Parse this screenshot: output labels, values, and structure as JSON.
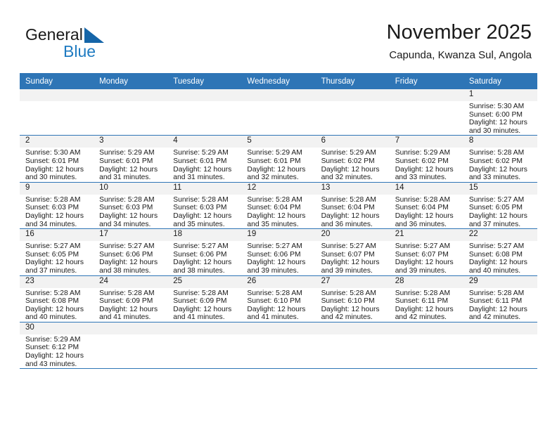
{
  "brand": {
    "name_top": "General",
    "name_bottom": "Blue",
    "flag_icon": "blue-flag-triangle-icon",
    "accent_color": "#1f7bc1"
  },
  "header": {
    "title": "November 2025",
    "subtitle": "Capunda, Kwanza Sul, Angola"
  },
  "theme": {
    "header_blue": "#2e75b6",
    "daynum_band": "#f2f2f2",
    "text": "#1a1a1a"
  },
  "calendar": {
    "weekday_headers": [
      "Sunday",
      "Monday",
      "Tuesday",
      "Wednesday",
      "Thursday",
      "Friday",
      "Saturday"
    ],
    "weeks": [
      [
        {
          "empty": true,
          "day": "",
          "sunrise": "",
          "sunset": "",
          "daylight_l1": "",
          "daylight_l2": ""
        },
        {
          "empty": true,
          "day": "",
          "sunrise": "",
          "sunset": "",
          "daylight_l1": "",
          "daylight_l2": ""
        },
        {
          "empty": true,
          "day": "",
          "sunrise": "",
          "sunset": "",
          "daylight_l1": "",
          "daylight_l2": ""
        },
        {
          "empty": true,
          "day": "",
          "sunrise": "",
          "sunset": "",
          "daylight_l1": "",
          "daylight_l2": ""
        },
        {
          "empty": true,
          "day": "",
          "sunrise": "",
          "sunset": "",
          "daylight_l1": "",
          "daylight_l2": ""
        },
        {
          "empty": true,
          "day": "",
          "sunrise": "",
          "sunset": "",
          "daylight_l1": "",
          "daylight_l2": ""
        },
        {
          "empty": false,
          "day": "1",
          "sunrise": "Sunrise: 5:30 AM",
          "sunset": "Sunset: 6:00 PM",
          "daylight_l1": "Daylight: 12 hours",
          "daylight_l2": "and 30 minutes."
        }
      ],
      [
        {
          "empty": false,
          "day": "2",
          "sunrise": "Sunrise: 5:30 AM",
          "sunset": "Sunset: 6:01 PM",
          "daylight_l1": "Daylight: 12 hours",
          "daylight_l2": "and 30 minutes."
        },
        {
          "empty": false,
          "day": "3",
          "sunrise": "Sunrise: 5:29 AM",
          "sunset": "Sunset: 6:01 PM",
          "daylight_l1": "Daylight: 12 hours",
          "daylight_l2": "and 31 minutes."
        },
        {
          "empty": false,
          "day": "4",
          "sunrise": "Sunrise: 5:29 AM",
          "sunset": "Sunset: 6:01 PM",
          "daylight_l1": "Daylight: 12 hours",
          "daylight_l2": "and 31 minutes."
        },
        {
          "empty": false,
          "day": "5",
          "sunrise": "Sunrise: 5:29 AM",
          "sunset": "Sunset: 6:01 PM",
          "daylight_l1": "Daylight: 12 hours",
          "daylight_l2": "and 32 minutes."
        },
        {
          "empty": false,
          "day": "6",
          "sunrise": "Sunrise: 5:29 AM",
          "sunset": "Sunset: 6:02 PM",
          "daylight_l1": "Daylight: 12 hours",
          "daylight_l2": "and 32 minutes."
        },
        {
          "empty": false,
          "day": "7",
          "sunrise": "Sunrise: 5:29 AM",
          "sunset": "Sunset: 6:02 PM",
          "daylight_l1": "Daylight: 12 hours",
          "daylight_l2": "and 33 minutes."
        },
        {
          "empty": false,
          "day": "8",
          "sunrise": "Sunrise: 5:28 AM",
          "sunset": "Sunset: 6:02 PM",
          "daylight_l1": "Daylight: 12 hours",
          "daylight_l2": "and 33 minutes."
        }
      ],
      [
        {
          "empty": false,
          "day": "9",
          "sunrise": "Sunrise: 5:28 AM",
          "sunset": "Sunset: 6:03 PM",
          "daylight_l1": "Daylight: 12 hours",
          "daylight_l2": "and 34 minutes."
        },
        {
          "empty": false,
          "day": "10",
          "sunrise": "Sunrise: 5:28 AM",
          "sunset": "Sunset: 6:03 PM",
          "daylight_l1": "Daylight: 12 hours",
          "daylight_l2": "and 34 minutes."
        },
        {
          "empty": false,
          "day": "11",
          "sunrise": "Sunrise: 5:28 AM",
          "sunset": "Sunset: 6:03 PM",
          "daylight_l1": "Daylight: 12 hours",
          "daylight_l2": "and 35 minutes."
        },
        {
          "empty": false,
          "day": "12",
          "sunrise": "Sunrise: 5:28 AM",
          "sunset": "Sunset: 6:04 PM",
          "daylight_l1": "Daylight: 12 hours",
          "daylight_l2": "and 35 minutes."
        },
        {
          "empty": false,
          "day": "13",
          "sunrise": "Sunrise: 5:28 AM",
          "sunset": "Sunset: 6:04 PM",
          "daylight_l1": "Daylight: 12 hours",
          "daylight_l2": "and 36 minutes."
        },
        {
          "empty": false,
          "day": "14",
          "sunrise": "Sunrise: 5:28 AM",
          "sunset": "Sunset: 6:04 PM",
          "daylight_l1": "Daylight: 12 hours",
          "daylight_l2": "and 36 minutes."
        },
        {
          "empty": false,
          "day": "15",
          "sunrise": "Sunrise: 5:27 AM",
          "sunset": "Sunset: 6:05 PM",
          "daylight_l1": "Daylight: 12 hours",
          "daylight_l2": "and 37 minutes."
        }
      ],
      [
        {
          "empty": false,
          "day": "16",
          "sunrise": "Sunrise: 5:27 AM",
          "sunset": "Sunset: 6:05 PM",
          "daylight_l1": "Daylight: 12 hours",
          "daylight_l2": "and 37 minutes."
        },
        {
          "empty": false,
          "day": "17",
          "sunrise": "Sunrise: 5:27 AM",
          "sunset": "Sunset: 6:06 PM",
          "daylight_l1": "Daylight: 12 hours",
          "daylight_l2": "and 38 minutes."
        },
        {
          "empty": false,
          "day": "18",
          "sunrise": "Sunrise: 5:27 AM",
          "sunset": "Sunset: 6:06 PM",
          "daylight_l1": "Daylight: 12 hours",
          "daylight_l2": "and 38 minutes."
        },
        {
          "empty": false,
          "day": "19",
          "sunrise": "Sunrise: 5:27 AM",
          "sunset": "Sunset: 6:06 PM",
          "daylight_l1": "Daylight: 12 hours",
          "daylight_l2": "and 39 minutes."
        },
        {
          "empty": false,
          "day": "20",
          "sunrise": "Sunrise: 5:27 AM",
          "sunset": "Sunset: 6:07 PM",
          "daylight_l1": "Daylight: 12 hours",
          "daylight_l2": "and 39 minutes."
        },
        {
          "empty": false,
          "day": "21",
          "sunrise": "Sunrise: 5:27 AM",
          "sunset": "Sunset: 6:07 PM",
          "daylight_l1": "Daylight: 12 hours",
          "daylight_l2": "and 39 minutes."
        },
        {
          "empty": false,
          "day": "22",
          "sunrise": "Sunrise: 5:27 AM",
          "sunset": "Sunset: 6:08 PM",
          "daylight_l1": "Daylight: 12 hours",
          "daylight_l2": "and 40 minutes."
        }
      ],
      [
        {
          "empty": false,
          "day": "23",
          "sunrise": "Sunrise: 5:28 AM",
          "sunset": "Sunset: 6:08 PM",
          "daylight_l1": "Daylight: 12 hours",
          "daylight_l2": "and 40 minutes."
        },
        {
          "empty": false,
          "day": "24",
          "sunrise": "Sunrise: 5:28 AM",
          "sunset": "Sunset: 6:09 PM",
          "daylight_l1": "Daylight: 12 hours",
          "daylight_l2": "and 41 minutes."
        },
        {
          "empty": false,
          "day": "25",
          "sunrise": "Sunrise: 5:28 AM",
          "sunset": "Sunset: 6:09 PM",
          "daylight_l1": "Daylight: 12 hours",
          "daylight_l2": "and 41 minutes."
        },
        {
          "empty": false,
          "day": "26",
          "sunrise": "Sunrise: 5:28 AM",
          "sunset": "Sunset: 6:10 PM",
          "daylight_l1": "Daylight: 12 hours",
          "daylight_l2": "and 41 minutes."
        },
        {
          "empty": false,
          "day": "27",
          "sunrise": "Sunrise: 5:28 AM",
          "sunset": "Sunset: 6:10 PM",
          "daylight_l1": "Daylight: 12 hours",
          "daylight_l2": "and 42 minutes."
        },
        {
          "empty": false,
          "day": "28",
          "sunrise": "Sunrise: 5:28 AM",
          "sunset": "Sunset: 6:11 PM",
          "daylight_l1": "Daylight: 12 hours",
          "daylight_l2": "and 42 minutes."
        },
        {
          "empty": false,
          "day": "29",
          "sunrise": "Sunrise: 5:28 AM",
          "sunset": "Sunset: 6:11 PM",
          "daylight_l1": "Daylight: 12 hours",
          "daylight_l2": "and 42 minutes."
        }
      ],
      [
        {
          "empty": false,
          "day": "30",
          "sunrise": "Sunrise: 5:29 AM",
          "sunset": "Sunset: 6:12 PM",
          "daylight_l1": "Daylight: 12 hours",
          "daylight_l2": "and 43 minutes."
        },
        {
          "empty": true,
          "day": "",
          "sunrise": "",
          "sunset": "",
          "daylight_l1": "",
          "daylight_l2": ""
        },
        {
          "empty": true,
          "day": "",
          "sunrise": "",
          "sunset": "",
          "daylight_l1": "",
          "daylight_l2": ""
        },
        {
          "empty": true,
          "day": "",
          "sunrise": "",
          "sunset": "",
          "daylight_l1": "",
          "daylight_l2": ""
        },
        {
          "empty": true,
          "day": "",
          "sunrise": "",
          "sunset": "",
          "daylight_l1": "",
          "daylight_l2": ""
        },
        {
          "empty": true,
          "day": "",
          "sunrise": "",
          "sunset": "",
          "daylight_l1": "",
          "daylight_l2": ""
        },
        {
          "empty": true,
          "day": "",
          "sunrise": "",
          "sunset": "",
          "daylight_l1": "",
          "daylight_l2": ""
        }
      ]
    ]
  }
}
